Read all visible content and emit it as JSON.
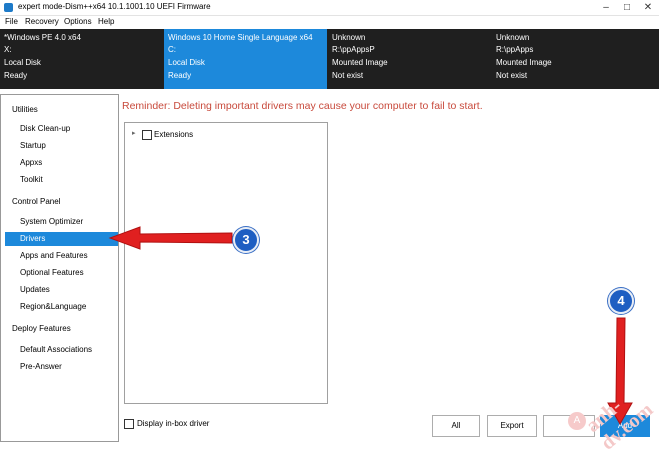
{
  "window": {
    "title": "expert mode-Dism++x64 10.1.1001.10 UEFI Firmware",
    "controls": [
      "–",
      "□",
      "✕"
    ]
  },
  "menu": [
    "File",
    "Recovery",
    "Options",
    "Help"
  ],
  "images": [
    {
      "name": "*Windows PE 4.0 x64",
      "drive": "X:",
      "type": "Local Disk",
      "status": "Ready",
      "selected": false
    },
    {
      "name": "Windows 10 Home Single Language x64",
      "drive": "C:",
      "type": "Local Disk",
      "status": "Ready",
      "selected": true
    },
    {
      "name": "Unknown",
      "drive": "R:\\ppAppsP",
      "type": "Mounted Image",
      "status": "Not exist",
      "selected": false
    },
    {
      "name": "Unknown",
      "drive": "R:\\ppApps",
      "type": "Mounted Image",
      "status": "Not exist",
      "selected": false
    }
  ],
  "sidebar": {
    "sections": [
      {
        "title": "Utilities",
        "items": [
          "Disk Clean-up",
          "Startup",
          "Appxs",
          "Toolkit"
        ]
      },
      {
        "title": "Control Panel",
        "items": [
          "System Optimizer",
          "Drivers",
          "Apps and Features",
          "Optional Features",
          "Updates",
          "Region&Language"
        ]
      },
      {
        "title": "Deploy Features",
        "items": [
          "Default Associations",
          "Pre-Answer"
        ]
      }
    ],
    "active": "Drivers"
  },
  "main": {
    "reminder": "Reminder: Deleting important drivers may cause your computer to fail to start.",
    "tree_item": "Extensions",
    "display_inbox": "Display in-box driver",
    "buttons": {
      "all": "All",
      "export": "Export",
      "add": "Add"
    }
  },
  "annotations": {
    "callout3": "3",
    "callout4": "4"
  },
  "watermark": {
    "text": "anh-dv.com",
    "logo": "A"
  },
  "colors": {
    "accent": "#1d89db",
    "reminder": "#c84a3c",
    "arrow": "#e02020",
    "image_bar": "#1f1f1f"
  }
}
